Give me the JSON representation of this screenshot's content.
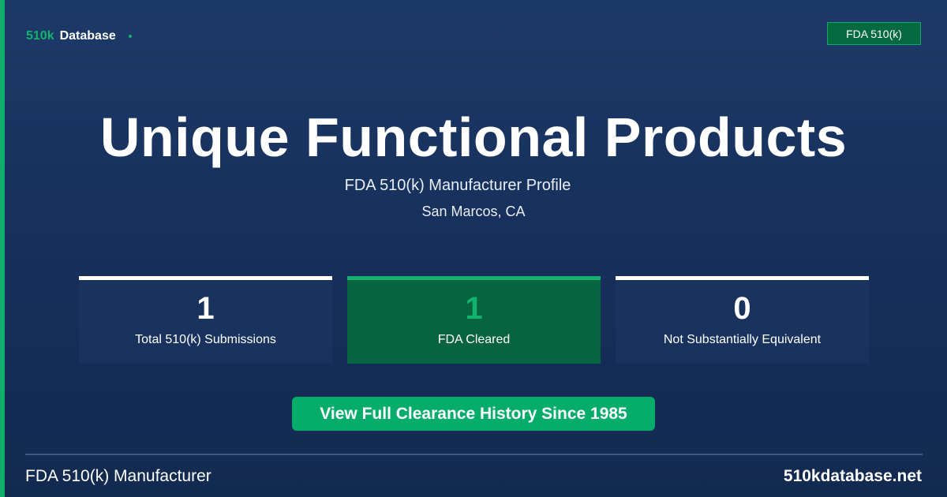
{
  "brand": {
    "accent": "510k",
    "name": "Database",
    "accent_color": "#12b36e"
  },
  "badge": {
    "label": "FDA 510(k)"
  },
  "header": {
    "title": "Unique Functional Products",
    "subtitle": "FDA 510(k) Manufacturer Profile",
    "location": "San Marcos, CA"
  },
  "stats": [
    {
      "value": "1",
      "label": "Total 510(k) Submissions"
    },
    {
      "value": "1",
      "label": "FDA Cleared"
    },
    {
      "value": "0",
      "label": "Not Substantially Equivalent"
    }
  ],
  "cta": {
    "label": "View Full Clearance History Since 1985"
  },
  "footer": {
    "left": "FDA 510(k) Manufacturer",
    "right": "510kdatabase.net"
  },
  "colors": {
    "background": "#17305c",
    "accent_green": "#12b36e",
    "highlight_card": "#086341"
  }
}
